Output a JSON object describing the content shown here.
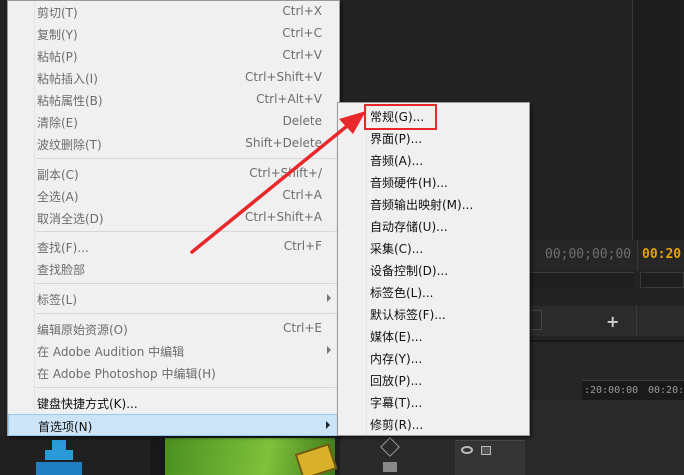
{
  "background": {
    "timecode_left": "00;00;00;00",
    "timecode_right": "00:20:",
    "ruler_left": ":20:00:00",
    "ruler_right": "00:20:1",
    "plus_label": "+"
  },
  "context_menu": {
    "items": [
      {
        "label": "剪切(T)",
        "shortcut": "Ctrl+X",
        "enabled": false
      },
      {
        "label": "复制(Y)",
        "shortcut": "Ctrl+C",
        "enabled": false
      },
      {
        "label": "粘帖(P)",
        "shortcut": "Ctrl+V",
        "enabled": false
      },
      {
        "label": "粘帖插入(I)",
        "shortcut": "Ctrl+Shift+V",
        "enabled": false
      },
      {
        "label": "粘帖属性(B)",
        "shortcut": "Ctrl+Alt+V",
        "enabled": false
      },
      {
        "label": "清除(E)",
        "shortcut": "Delete",
        "enabled": false
      },
      {
        "label": "波纹删除(T)",
        "shortcut": "Shift+Delete",
        "enabled": false
      },
      {
        "label": "副本(C)",
        "shortcut": "Ctrl+Shift+/",
        "enabled": false
      },
      {
        "label": "全选(A)",
        "shortcut": "Ctrl+A",
        "enabled": false
      },
      {
        "label": "取消全选(D)",
        "shortcut": "Ctrl+Shift+A",
        "enabled": false
      },
      {
        "label": "查找(F)...",
        "shortcut": "Ctrl+F",
        "enabled": false
      },
      {
        "label": "查找脸部",
        "shortcut": "",
        "enabled": false
      },
      {
        "label": "标签(L)",
        "shortcut": "",
        "enabled": false
      },
      {
        "label": "编辑原始资源(O)",
        "shortcut": "Ctrl+E",
        "enabled": false
      },
      {
        "label": "在 Adobe Audition 中编辑",
        "shortcut": "",
        "enabled": false
      },
      {
        "label": "在 Adobe Photoshop 中编辑(H)",
        "shortcut": "",
        "enabled": false
      },
      {
        "label": "键盘快捷方式(K)...",
        "shortcut": "",
        "enabled": true
      },
      {
        "label": "首选项(N)",
        "shortcut": "",
        "enabled": true
      }
    ]
  },
  "preferences_submenu": {
    "items": [
      "常规(G)...",
      "界面(P)...",
      "音频(A)...",
      "音频硬件(H)...",
      "音频输出映射(M)...",
      "自动存储(U)...",
      "采集(C)...",
      "设备控制(D)...",
      "标签色(L)...",
      "默认标签(F)...",
      "媒体(E)...",
      "内存(Y)...",
      "回放(P)...",
      "字幕(T)...",
      "修剪(R)..."
    ]
  },
  "colors": {
    "menu_bg": "#f0f0f0",
    "highlight_bg": "#cce4f7",
    "annotation_red": "#e8282a",
    "timecode_accent": "#e6a100"
  }
}
